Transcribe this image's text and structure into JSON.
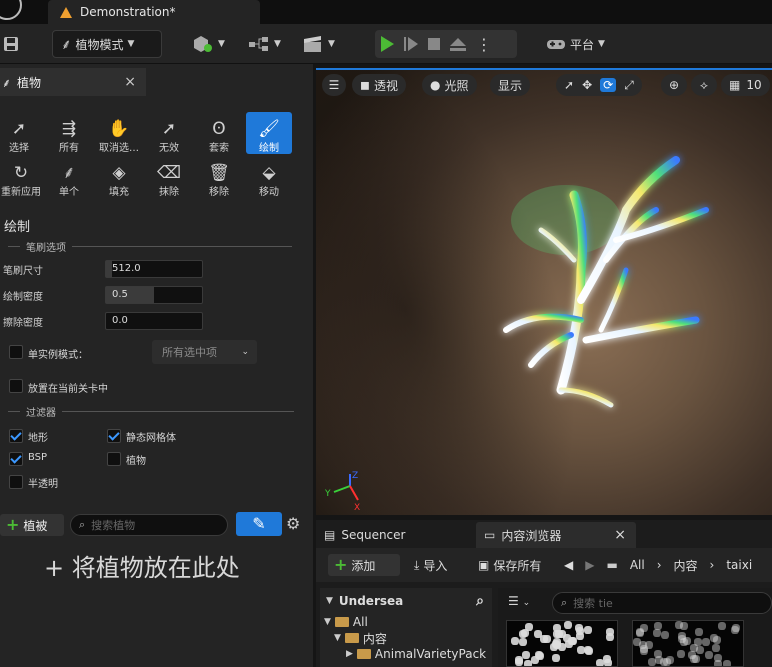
{
  "window": {
    "doc_title": "Demonstration*"
  },
  "toolbar": {
    "mode_label": "植物模式",
    "platform_label": "平台"
  },
  "panel": {
    "tab_title": "植物",
    "close": "×"
  },
  "tools": [
    {
      "label": "选择",
      "icon": "cursor-icon"
    },
    {
      "label": "所有",
      "icon": "select-all-icon"
    },
    {
      "label": "取消选…",
      "icon": "hand-icon"
    },
    {
      "label": "无效",
      "icon": "invalid-icon"
    },
    {
      "label": "套索",
      "icon": "lasso-icon"
    },
    {
      "label": "绘制",
      "icon": "brush-icon"
    },
    {
      "label": "重新应用",
      "icon": "reapply-icon"
    },
    {
      "label": "单个",
      "icon": "single-icon"
    },
    {
      "label": "填充",
      "icon": "fill-icon"
    },
    {
      "label": "抹除",
      "icon": "erase-icon"
    },
    {
      "label": "移除",
      "icon": "trash-icon"
    },
    {
      "label": "移动",
      "icon": "move-icon"
    }
  ],
  "paint": {
    "section_title": "绘制",
    "brush_group": "笔刷选项",
    "brush_size_label": "笔刷尺寸",
    "brush_size_value": "512.0",
    "paint_density_label": "绘制密度",
    "paint_density_value": "0.5",
    "paint_density_fill": 0.5,
    "erase_density_label": "擦除密度",
    "erase_density_value": "0.0",
    "single_instance_label": "单实例模式：",
    "single_instance_dropdown": "所有选中项",
    "place_in_level_label": "放置在当前关卡中",
    "filter_group": "过滤器",
    "filters": {
      "landscape": {
        "label": "地形",
        "checked": true
      },
      "static_mesh": {
        "label": "静态网格体",
        "checked": true
      },
      "bsp": {
        "label": "BSP",
        "checked": true
      },
      "foliage": {
        "label": "植物",
        "checked": false
      },
      "translucent": {
        "label": "半透明",
        "checked": false
      }
    }
  },
  "foliage_list": {
    "add_label": "植被",
    "search_placeholder": "搜索植物",
    "drop_hint": "+ 将植物放在此处"
  },
  "viewport": {
    "perspective": "透视",
    "lighting": "光照",
    "show": "显示",
    "grid_value": "10"
  },
  "dock": {
    "sequencer_tab": "Sequencer",
    "content_browser_tab": "内容浏览器",
    "add_label": "添加",
    "import_label": "导入",
    "save_all_label": "保存所有",
    "breadcrumbs": [
      "All",
      "内容",
      "taixi"
    ],
    "tree_title": "Undersea",
    "tree_items": [
      "All",
      "内容",
      "AnimalVarietyPack"
    ],
    "asset_search_placeholder": "搜索 tie"
  }
}
